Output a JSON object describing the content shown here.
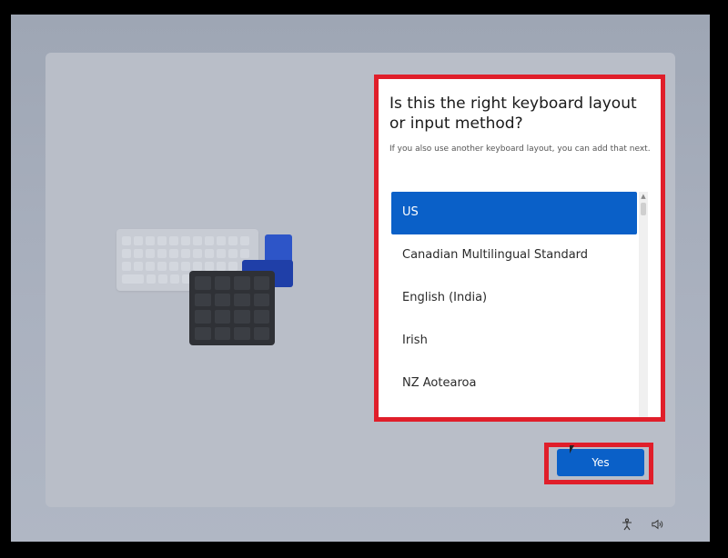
{
  "dialog": {
    "title": "Is this the right keyboard layout or input method?",
    "subtitle": "If you also use another keyboard layout, you can add that next.",
    "layouts": [
      {
        "label": "US",
        "selected": true
      },
      {
        "label": "Canadian Multilingual Standard",
        "selected": false
      },
      {
        "label": "English (India)",
        "selected": false
      },
      {
        "label": "Irish",
        "selected": false
      },
      {
        "label": "NZ Aotearoa",
        "selected": false
      }
    ]
  },
  "actions": {
    "yes_label": "Yes"
  },
  "tray": {
    "icons": [
      "accessibility-icon",
      "volume-icon"
    ]
  },
  "colors": {
    "accent": "#0a60c8",
    "highlight": "#e01e2a"
  }
}
